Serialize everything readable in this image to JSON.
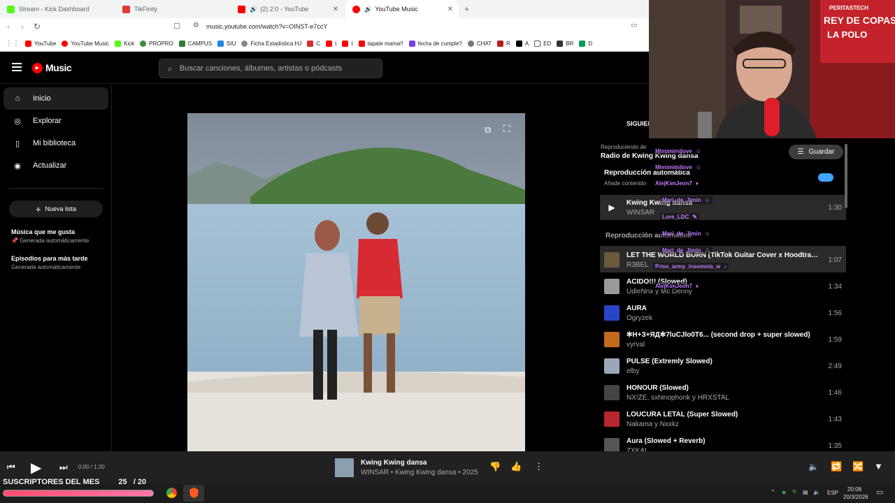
{
  "browser": {
    "tabs": [
      {
        "label": "Stream - Kick Dashboard",
        "favicon_color": "#53fc18"
      },
      {
        "label": "TikFinity",
        "favicon_color": "#e53935"
      },
      {
        "label": "(2) 2:0 - YouTube",
        "favicon_color": "#ff0000"
      },
      {
        "label": "YouTube Music",
        "favicon_color": "#ff0000"
      }
    ],
    "url": "music.youtube.com/watch?v=OINST-e7ccY",
    "bookmarks": [
      "YouTube",
      "YouTube Music",
      "Kick",
      "PROPRO",
      "CAMPUS",
      "SIU",
      "Ficha Estadística HJ",
      "C",
      "t",
      "t",
      "tapate mama!!",
      "fecha de cumple?",
      "CHAT",
      "R",
      "A",
      "ED",
      "BR",
      "D"
    ]
  },
  "app": {
    "logo": "Music",
    "search_placeholder": "Buscar canciones, álbumes, artistas o pódcasts",
    "nav": [
      {
        "label": "Inicio",
        "icon": "home-icon"
      },
      {
        "label": "Explorar",
        "icon": "explore-icon"
      },
      {
        "label": "Mi biblioteca",
        "icon": "library-icon"
      },
      {
        "label": "Actualizar",
        "icon": "upgrade-icon"
      }
    ],
    "new_list": "Nueva lista",
    "playlists": [
      {
        "title": "Música que me gusta",
        "subtitle": "Generada automáticamente"
      },
      {
        "title": "Episodios para más tarde",
        "subtitle": "Generada automáticamente"
      }
    ]
  },
  "queue": {
    "tab_next": "SIGUIEN",
    "playing_from_label": "Reproduciendo de",
    "playing_from": "Radio de Kwing Kwing dansa",
    "autoplay_title": "Reproducción automática",
    "autoplay_sub": "Añade contenido",
    "now_playing": {
      "title": "Kwing Kwing dansa",
      "artist": "WINSAR",
      "duration": "1:30"
    },
    "section": "Reproducción automática",
    "items": [
      {
        "title": "LET THE WORLD BURN (TikTok Guitar Cover x Hoodtrap ...",
        "artist": "R3BEL",
        "duration": "1:07",
        "color": "#6b5a3a"
      },
      {
        "title": "ACIDO!!! (Slowed)",
        "artist": "UdieNnx y Mc Denny",
        "duration": "1:34",
        "color": "#999999"
      },
      {
        "title": "AURA",
        "artist": "Ogryzek",
        "duration": "1:56",
        "color": "#2a46c8"
      },
      {
        "title": "✻Н+З+ЯД✻7luCJlo0T6... (second drop + super slowed)",
        "artist": "vyrval",
        "duration": "1:59",
        "color": "#c26a1e"
      },
      {
        "title": "PULSE (Extremly Slowed)",
        "artist": "elby",
        "duration": "2:49",
        "color": "#9aa7b8"
      },
      {
        "title": "HONOUR (Slowed)",
        "artist": "NX!ZE, sxhinophonk y HRXSTAL",
        "duration": "1:46",
        "color": "#444444"
      },
      {
        "title": "LOUCURA LETAL (Super Slowed)",
        "artist": "Nakama y Nxxkz",
        "duration": "1:43",
        "color": "#b8262e"
      },
      {
        "title": "Aura (Slowed + Reverb)",
        "artist": "ZXKAI",
        "duration": "1:35",
        "color": "#555555"
      }
    ]
  },
  "chat": {
    "save_label": "Guardar",
    "lines": [
      "Mimimimilove",
      "Mimimimilove",
      "AlejKimJeon7",
      "Mari_de_Jimin",
      "Lore_LDC",
      "Mari_de_Jimin",
      "Mari_de_Jimin",
      "Priss_army_insomnia_w",
      "AlejKimJeon7"
    ]
  },
  "player": {
    "time": "0:00 / 1:30",
    "title": "Kwing Kwing dansa",
    "subtitle": "WINSAR • Kwing Kwing dansa • 2025"
  },
  "overlay": {
    "subs_label": "SUSCRIPTORES DEL MES",
    "subs_count": "25",
    "subs_goal": "/ 20",
    "subs_progress": 1.0
  },
  "taskbar": {
    "lang": "ESP",
    "time": "20:08",
    "date": "20/3/2026"
  }
}
